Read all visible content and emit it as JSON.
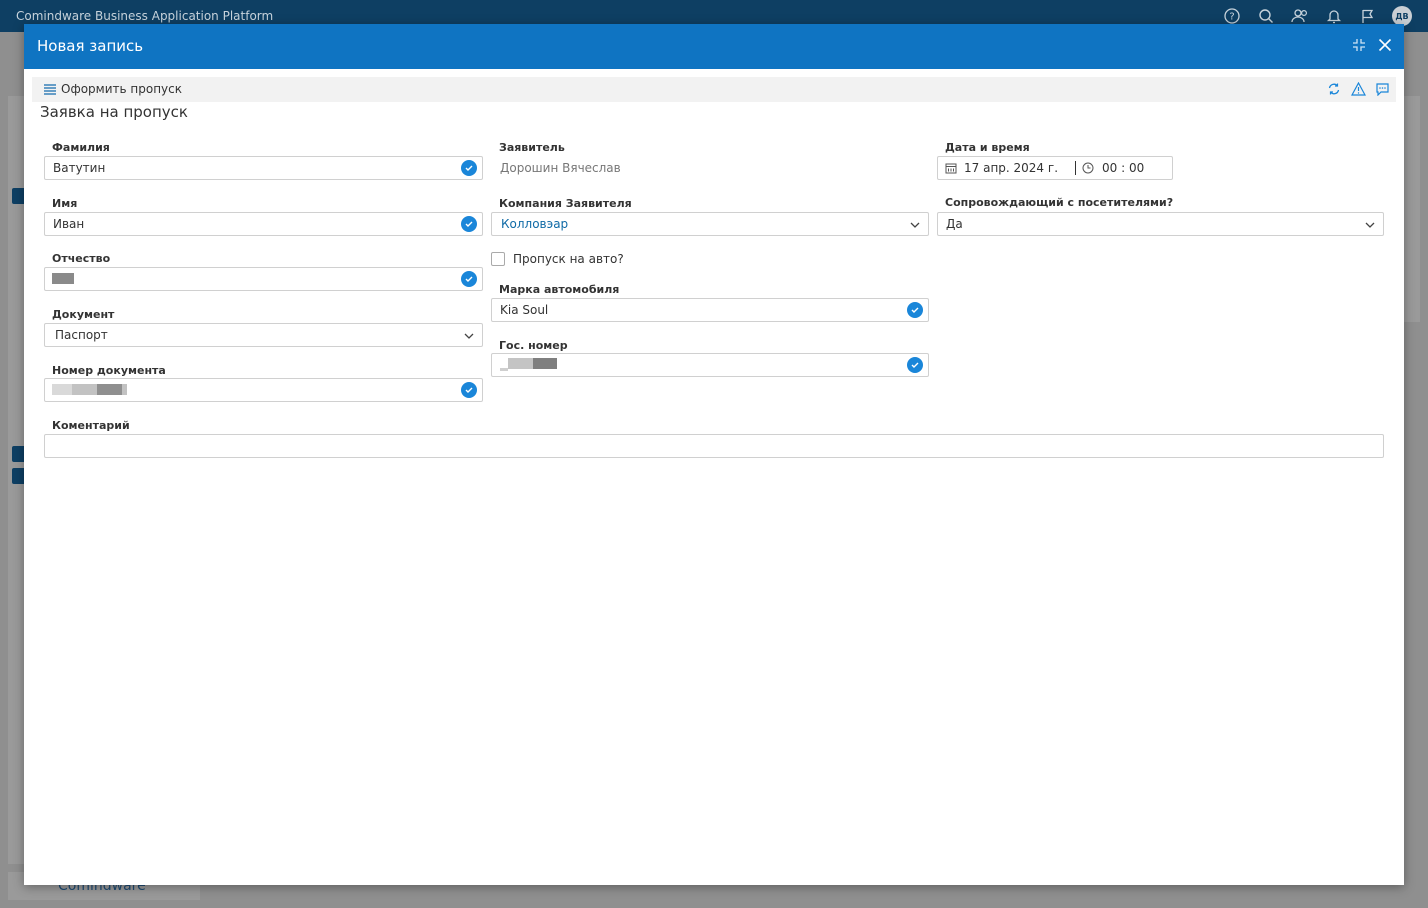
{
  "app": {
    "title": "Comindware Business Application Platform",
    "user_initials": "ДВ",
    "footer_brand": "Comindware"
  },
  "modal": {
    "title": "Новая запись",
    "toolbar_menu_label": "Оформить пропуск",
    "form_title": "Заявка на пропуск"
  },
  "fields": {
    "lastname": {
      "label": "Фамилия",
      "value": "Ватутин"
    },
    "firstname": {
      "label": "Имя",
      "value": "Иван"
    },
    "patronymic": {
      "label": "Отчество"
    },
    "document": {
      "label": "Документ",
      "value": "Паспорт"
    },
    "document_number": {
      "label": "Номер документа"
    },
    "applicant": {
      "label": "Заявитель",
      "value": "Дорошин Вячеслав"
    },
    "company": {
      "label": "Компания Заявителя",
      "value": "Колловэар"
    },
    "car_pass": {
      "label": "Пропуск на авто?"
    },
    "car_brand": {
      "label": "Марка автомобиля",
      "value": "Kia Soul"
    },
    "plate": {
      "label": "Гос. номер"
    },
    "datetime": {
      "label": "Дата и время",
      "date": "17 апр. 2024 г.",
      "time": "00 : 00"
    },
    "escort": {
      "label": "Сопровождающий с посетителями?",
      "value": "Да"
    },
    "comment": {
      "label": "Коментарий",
      "value": ""
    }
  },
  "colors": {
    "header_blue": "#0f74c2",
    "appbar": "#0e3f63",
    "check_blue": "#1a86d9"
  }
}
